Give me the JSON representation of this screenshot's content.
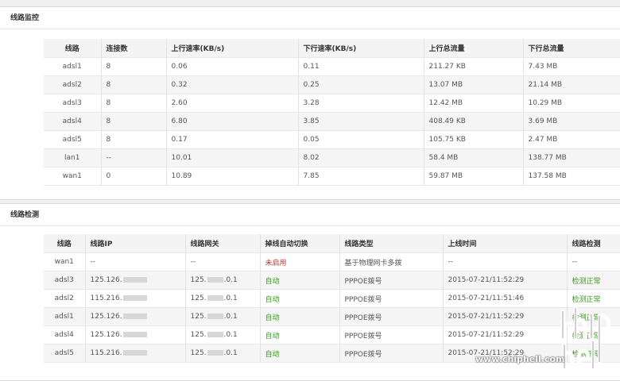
{
  "monitor": {
    "title": "线路监控",
    "headers": [
      "线路",
      "连接数",
      "上行速率(KB/s)",
      "下行速率(KB/s)",
      "上行总流量",
      "下行总流量"
    ],
    "rows": [
      [
        "adsl1",
        "8",
        "0.06",
        "0.11",
        "211.27 KB",
        "7.43 MB"
      ],
      [
        "adsl2",
        "8",
        "0.32",
        "0.25",
        "13.07 MB",
        "21.14 MB"
      ],
      [
        "adsl3",
        "8",
        "2.60",
        "3.28",
        "12.42 MB",
        "10.29 MB"
      ],
      [
        "adsl4",
        "8",
        "6.80",
        "3.85",
        "408.49 KB",
        "3.69 MB"
      ],
      [
        "adsl5",
        "8",
        "0.17",
        "0.05",
        "105.75 KB",
        "2.47 MB"
      ],
      [
        "lan1",
        "--",
        "10.01",
        "8.02",
        "58.4 MB",
        "138.77 MB"
      ],
      [
        "wan1",
        "0",
        "10.89",
        "7.85",
        "59.87 MB",
        "137.58 MB"
      ]
    ]
  },
  "detect": {
    "title": "线路检测",
    "headers": [
      "线路",
      "线路IP",
      "线路网关",
      "掉线自动切换",
      "线路类型",
      "上线时间",
      "线路检测"
    ],
    "rows": [
      {
        "line": "wan1",
        "ip": "--",
        "gw": "--",
        "switch": "未启用",
        "type": "基于物理网卡多拨",
        "time": "--",
        "check": "--"
      },
      {
        "line": "adsl3",
        "ip": "125.126.",
        "gw": "125.",
        "gw_tail": ".0.1",
        "switch": "自动",
        "type": "PPPOE拨号",
        "time": "2015-07-21/11:52:29",
        "check": "检测正常"
      },
      {
        "line": "adsl2",
        "ip": "115.216.",
        "gw": "125.",
        "gw_tail": ".0.1",
        "switch": "自动",
        "type": "PPPOE拨号",
        "time": "2015-07-21/11:51:46",
        "check": "检测正常"
      },
      {
        "line": "adsl1",
        "ip": "125.126.",
        "gw": "125.",
        "gw_tail": ".0.1",
        "switch": "自动",
        "type": "PPPOE拨号",
        "time": "2015-07-21/11:52:29",
        "check": "检测正常"
      },
      {
        "line": "adsl4",
        "ip": "125.126.",
        "gw": "125.",
        "gw_tail": ".0.1",
        "switch": "自动",
        "type": "PPPOE拨号",
        "time": "2015-07-21/11:52:29",
        "check": "检测正常"
      },
      {
        "line": "adsl5",
        "ip": "115.216.",
        "gw": "125.",
        "gw_tail": ".0.1",
        "switch": "自动",
        "type": "PPPOE拨号",
        "time": "2015-07-21/11:52:29",
        "check": "检测正常"
      }
    ]
  },
  "watermark": {
    "text": "www.chiphell.com",
    "logo": "chiphell"
  }
}
